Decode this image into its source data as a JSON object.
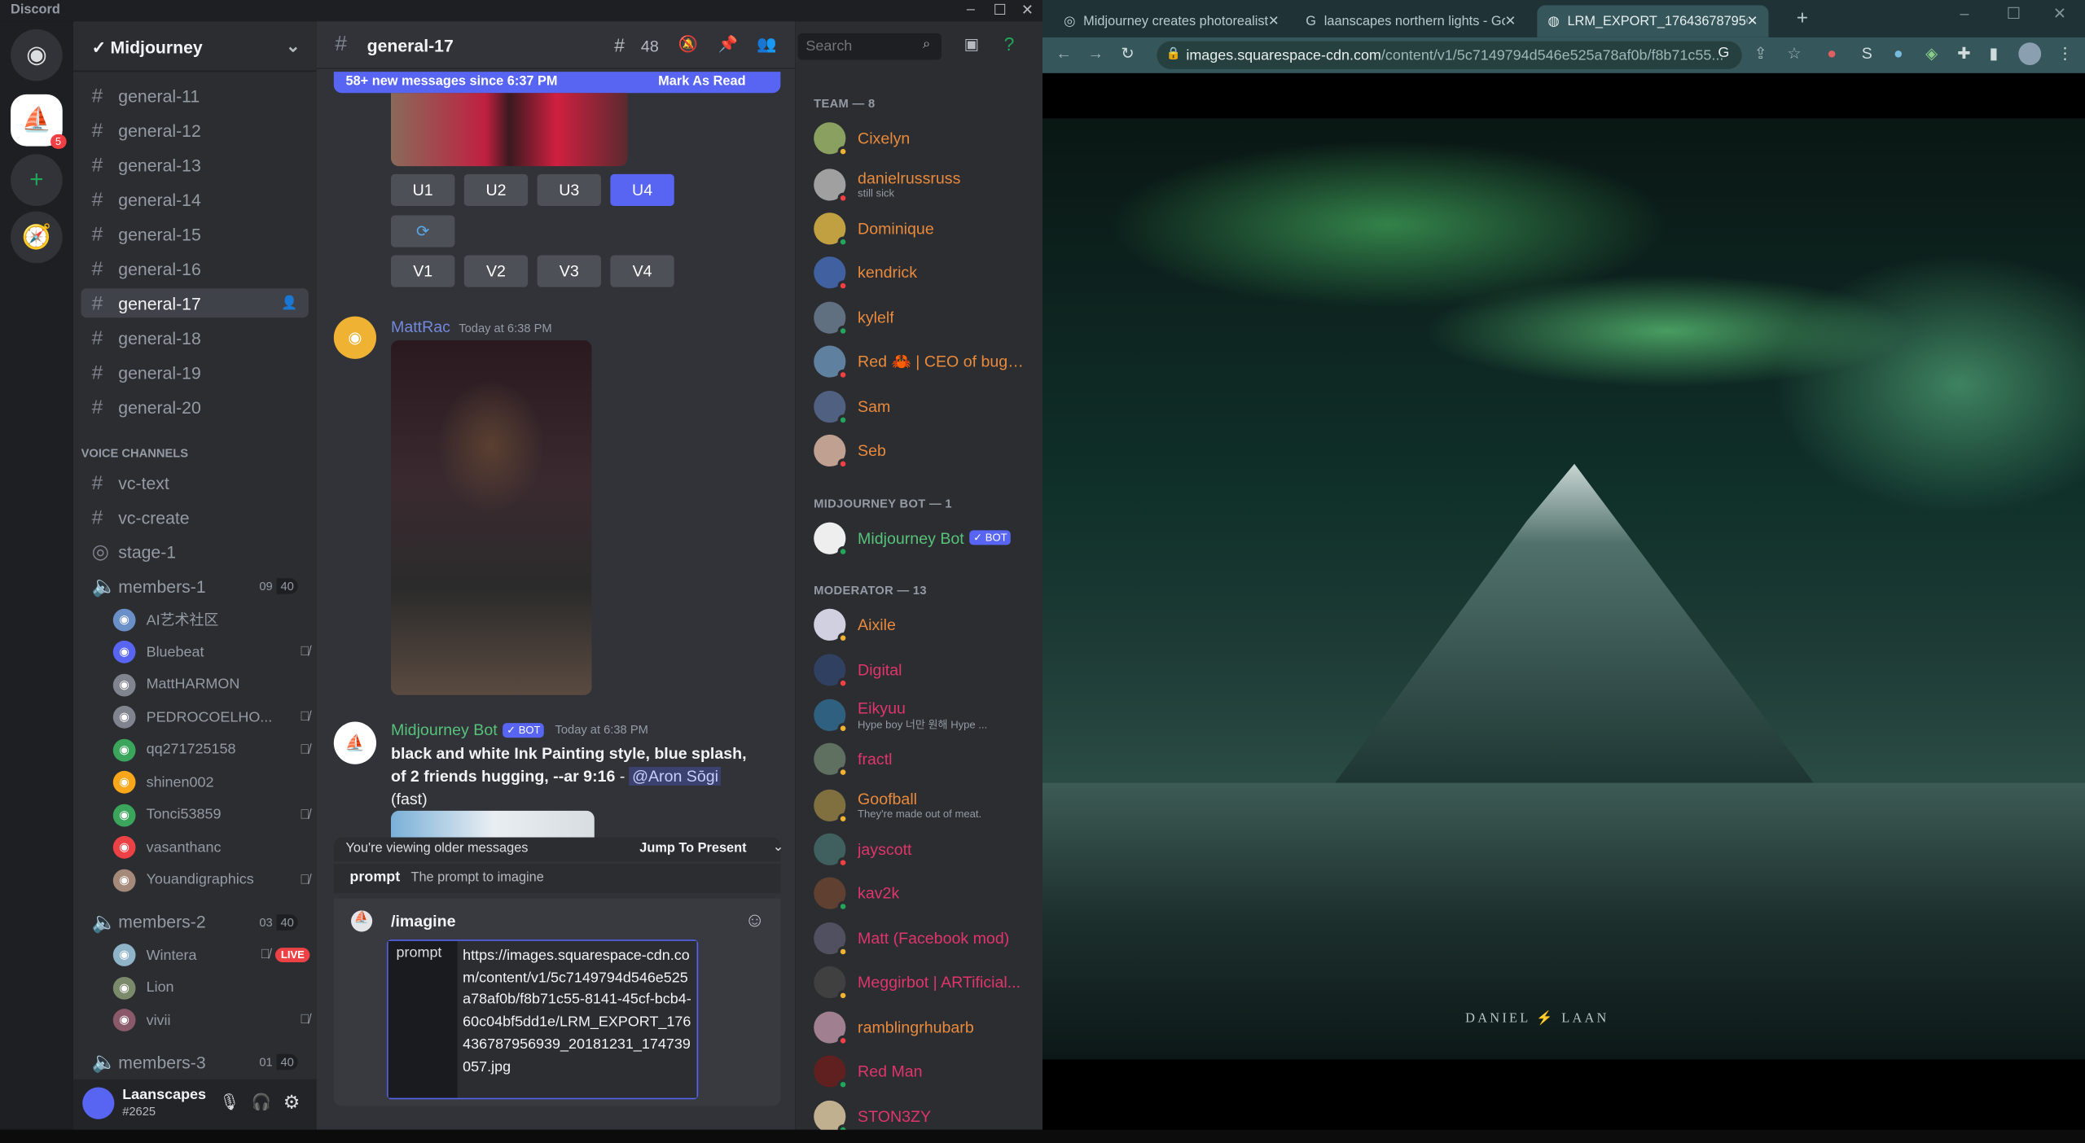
{
  "app": {
    "title": "Discord"
  },
  "server": {
    "name": "Midjourney",
    "badge": "5"
  },
  "channels": [
    "general-11",
    "general-12",
    "general-13",
    "general-14",
    "general-15",
    "general-16",
    "general-17",
    "general-18",
    "general-19",
    "general-20"
  ],
  "selected_channel": "general-17",
  "voice": {
    "header": "VOICE CHANNELS",
    "text_channels": [
      "vc-text",
      "vc-create"
    ],
    "stage": "stage-1",
    "groups": [
      {
        "name": "members-1",
        "count": "09",
        "limit": "40",
        "users": [
          {
            "name": "AI艺术社区",
            "color": "#6b8fc9"
          },
          {
            "name": "Bluebeat",
            "color": "#5865f2",
            "muted": true
          },
          {
            "name": "MattHARMON",
            "color": "#80848e"
          },
          {
            "name": "PEDROCOELHO...",
            "color": "#80848e",
            "muted": true
          },
          {
            "name": "qq271725158",
            "color": "#3ba55c",
            "muted": true
          },
          {
            "name": "shinen002",
            "color": "#faa61a"
          },
          {
            "name": "Tonci53859",
            "color": "#3ba55c",
            "muted": true
          },
          {
            "name": "vasanthanc",
            "color": "#ed4245"
          },
          {
            "name": "Youandigraphics",
            "color": "#a58a7a",
            "muted": true
          }
        ]
      },
      {
        "name": "members-2",
        "count": "03",
        "limit": "40",
        "users": [
          {
            "name": "Wintera",
            "color": "#8fb3c9",
            "muted": true,
            "live": "LIVE"
          },
          {
            "name": "Lion",
            "color": "#7a8a6a"
          },
          {
            "name": "vivii",
            "color": "#8a5a6a",
            "muted": true
          }
        ]
      },
      {
        "name": "members-3",
        "count": "01",
        "limit": "40",
        "users": []
      }
    ]
  },
  "user": {
    "name": "Laanscapes",
    "tag": "#2625"
  },
  "chat": {
    "channel": "general-17",
    "threads": "48",
    "search_placeholder": "Search",
    "banner": {
      "text": "58+ new messages since 6:37 PM",
      "action": "Mark As Read"
    },
    "upscale": [
      "U1",
      "U2",
      "U3",
      "U4"
    ],
    "variation": [
      "V1",
      "V2",
      "V3",
      "V4"
    ],
    "active_upscale": "U4",
    "messages": [
      {
        "author": "MattRac",
        "time": "Today at 6:38 PM"
      },
      {
        "author": "Midjourney Bot",
        "badge": "✓ BOT",
        "time": "Today at 6:38 PM",
        "text": "black and white Ink Painting style, blue splash, of 2 friends hugging, --ar 9:16",
        "mention": "@Aron Sōgi",
        "speed": "(fast)"
      }
    ],
    "older_bar": {
      "text": "You're viewing older messages",
      "action": "Jump To Present"
    },
    "hint": {
      "option": "prompt",
      "desc": "The prompt to imagine"
    },
    "command": "/imagine",
    "prompt_label": "prompt",
    "prompt_value": "https://images.squarespace-cdn.com/content/v1/5c7149794d546e525a78af0b/f8b71c55-8141-45cf-bcb4-60c04bf5dd1e/LRM_EXPORT_176436787956939_20181231_174739057.jpg"
  },
  "members": {
    "groups": [
      {
        "header": "TEAM — 8",
        "color": "#e98a3c",
        "items": [
          {
            "name": "Cixelyn",
            "status": "idle"
          },
          {
            "name": "danielrussruss",
            "sub": "still sick",
            "status": "dnd"
          },
          {
            "name": "Dominique",
            "status": "online"
          },
          {
            "name": "kendrick",
            "status": "dnd"
          },
          {
            "name": "kylelf",
            "status": "online"
          },
          {
            "name": "Red 🦀 | CEO of bugs ...",
            "status": "dnd"
          },
          {
            "name": "Sam",
            "status": "online"
          },
          {
            "name": "Seb",
            "status": "dnd"
          }
        ]
      },
      {
        "header": "MIDJOURNEY BOT — 1",
        "color": "#57c27a",
        "items": [
          {
            "name": "Midjourney Bot",
            "badge": "✓ BOT",
            "status": "online"
          }
        ]
      },
      {
        "header": "MODERATOR — 13",
        "color": "#e0356b",
        "items": [
          {
            "name": "Aixile",
            "status": "idle",
            "color": "#e98a3c"
          },
          {
            "name": "Digital",
            "status": "dnd"
          },
          {
            "name": "Eikyuu",
            "sub": "Hype boy 너만 원해 Hype ...",
            "status": "idle"
          },
          {
            "name": "fractl",
            "status": "idle"
          },
          {
            "name": "Goofball",
            "sub": "They're made out of meat.",
            "status": "idle",
            "color": "#e98a3c"
          },
          {
            "name": "jayscott",
            "status": "dnd"
          },
          {
            "name": "kav2k",
            "status": "online"
          },
          {
            "name": "Matt (Facebook mod)",
            "status": "idle"
          },
          {
            "name": "Meggirbot | ARTificial...",
            "status": "idle"
          },
          {
            "name": "ramblingrhubarb",
            "status": "dnd",
            "color": "#e98a3c"
          },
          {
            "name": "Red Man",
            "status": "online"
          },
          {
            "name": "STON3ZY",
            "status": "online"
          }
        ]
      }
    ]
  },
  "browser": {
    "tabs": [
      {
        "title": "Midjourney creates photorealisti"
      },
      {
        "title": "laanscapes northern lights - Goo"
      },
      {
        "title": "LRM_EXPORT_17643678795693"
      }
    ],
    "url_host": "images.squarespace-cdn.com",
    "url_path": "/content/v1/5c7149794d546e525a78af0b/f8b71c55...",
    "watermark": "DANIEL LAAN"
  },
  "colors": {
    "blurple": "#5865f2",
    "online": "#23a55a",
    "idle": "#f0b232",
    "dnd": "#f23f43"
  }
}
